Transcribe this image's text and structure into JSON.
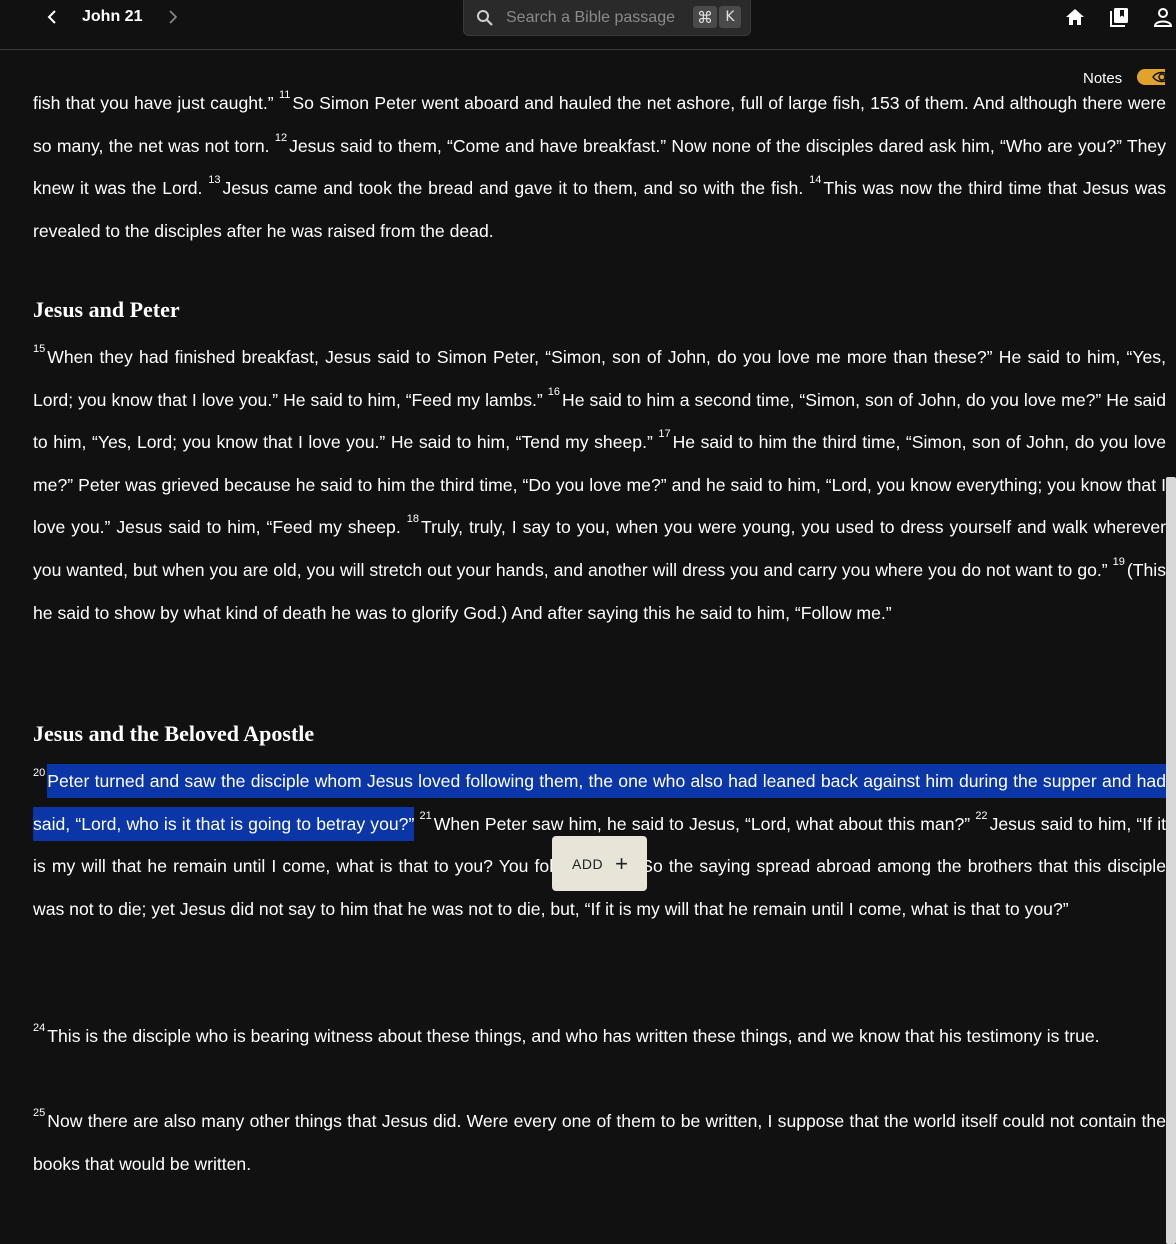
{
  "header": {
    "chapter_title": "John 21",
    "search_placeholder": "Search a Bible passage",
    "shortcut_cmd": "⌘",
    "shortcut_key": "K"
  },
  "notes": {
    "label": "Notes",
    "toggle_on": true,
    "accent": "#e0a42c"
  },
  "colors": {
    "background": "#121111",
    "highlight": "#0a36a8",
    "popup": "#e8e4d8"
  },
  "passage": {
    "p1": {
      "t1": "fish that you have just caught.”",
      "v11": "11",
      "t11": "So Simon Peter went aboard and hauled the net ashore, full of large fish, 153 of them. And although there were so many, the net was not torn.",
      "v12": "12",
      "t12": "Jesus said to them, “Come and have breakfast.” Now none of the disciples dared ask him, “Who are you?” They knew it was the Lord.",
      "v13": "13",
      "t13": "Jesus came and took the bread and gave it to them, and so with the fish.",
      "v14": "14",
      "t14": "This was now the third time that Jesus was revealed to the disciples after he was raised from the dead."
    },
    "heading1": "Jesus and Peter",
    "p2": {
      "v15": "15",
      "t15": "When they had finished breakfast, Jesus said to Simon Peter, “Simon, son of John, do you love me more than these?” He said to him, “Yes, Lord; you know that I love you.” He said to him, “Feed my lambs.”",
      "v16": "16",
      "t16": "He said to him a second time, “Simon, son of John, do you love me?” He said to him, “Yes, Lord; you know that I love you.” He said to him, “Tend my sheep.”",
      "v17": "17",
      "t17": "He said to him the third time, “Simon, son of John, do you love me?” Peter was grieved because he said to him the third time, “Do you love me?” and he said to him, “Lord, you know everything; you know that I love you.” Jesus said to him, “Feed my sheep.",
      "v18": "18",
      "t18": "Truly, truly, I say to you, when you were young, you used to dress yourself and walk wherever you wanted, but when you are old, you will stretch out your hands, and another will dress you and carry you where you do not want to go.”",
      "v19": "19",
      "t19": "(This he said to show by what kind of death he was to glorify God.) And after saying this he said to him, “Follow me.”"
    },
    "heading2": "Jesus and the Beloved Apostle",
    "p3": {
      "v20": "20",
      "t20": "Peter turned and saw the disciple whom Jesus loved following them, the one who also had leaned back against him during the supper and had said, “Lord, who is it that is going to betray you?”",
      "v21": "21",
      "t21": "When Peter saw him, he said to Jesus, “Lord, what about this man?”",
      "v22": "22",
      "t22": "Jesus said to him, “If it is my will that he remain until I come, what is that to you? You follow me!”",
      "v23": "23",
      "t23": "So the saying spread abroad among the brothers that this disciple was not to die; yet Jesus did not say to him that he was not to die, but, “If it is my will that he remain until I come, what is that to you?”"
    },
    "p4": {
      "v24": "24",
      "t24": "This is the disciple who is bearing witness about these things, and who has written these things, and we know that his testimony is true."
    },
    "p5": {
      "v25": "25",
      "t25": "Now there are also many other things that Jesus did. Were every one of them to be written, I suppose that the world itself could not contain the books that would be written."
    }
  },
  "popup": {
    "add_label": "ADD",
    "plus": "+"
  }
}
